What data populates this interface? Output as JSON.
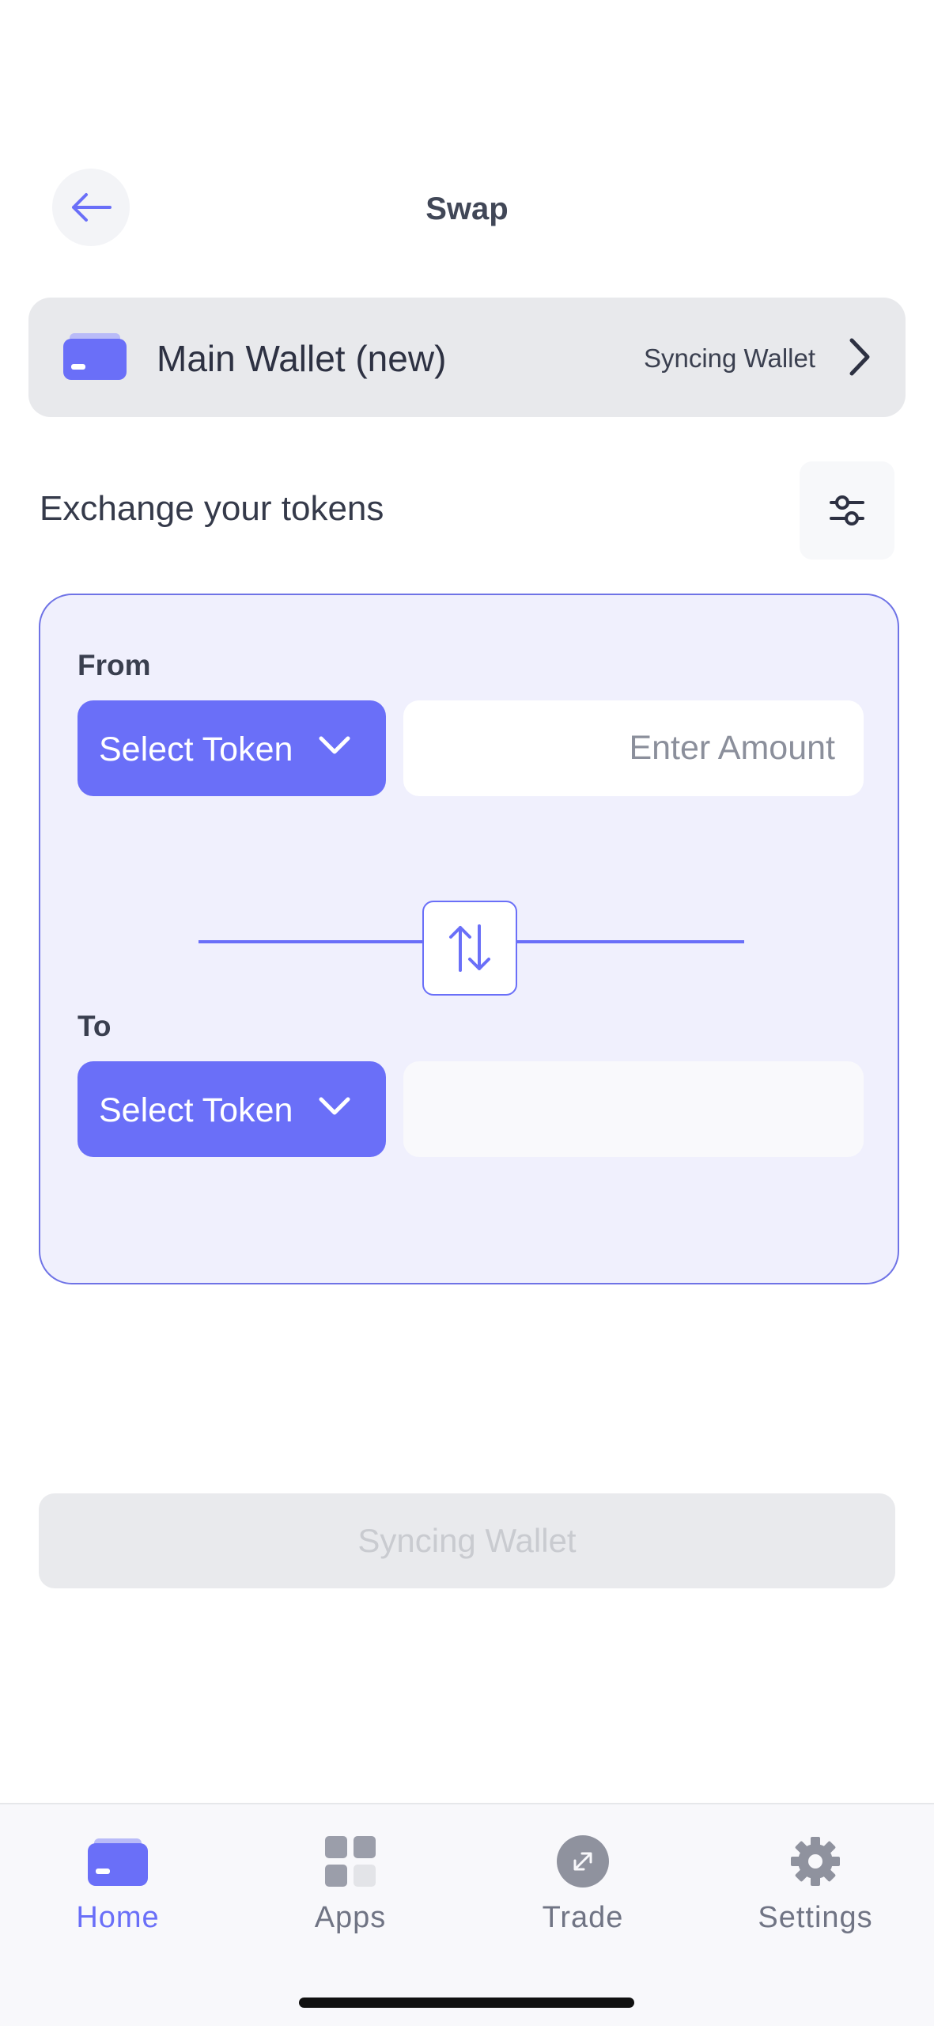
{
  "header": {
    "title": "Swap"
  },
  "wallet": {
    "name": "Main Wallet (new)",
    "status": "Syncing Wallet"
  },
  "exchange": {
    "label": "Exchange your tokens"
  },
  "from": {
    "label": "From",
    "token_select": "Select Token",
    "amount_placeholder": "Enter Amount"
  },
  "to": {
    "label": "To",
    "token_select": "Select Token",
    "amount_placeholder": ""
  },
  "action": {
    "label": "Syncing Wallet"
  },
  "tabs": [
    {
      "label": "Home",
      "icon": "wallet-icon",
      "active": true
    },
    {
      "label": "Apps",
      "icon": "apps-grid-icon",
      "active": false
    },
    {
      "label": "Trade",
      "icon": "trade-icon",
      "active": false
    },
    {
      "label": "Settings",
      "icon": "gear-icon",
      "active": false
    }
  ],
  "colors": {
    "accent": "#6a6ff8",
    "card_bg": "#f0f0fd",
    "wallet_bar_bg": "#e8e9ec",
    "disabled_button": "#e9eaed"
  }
}
